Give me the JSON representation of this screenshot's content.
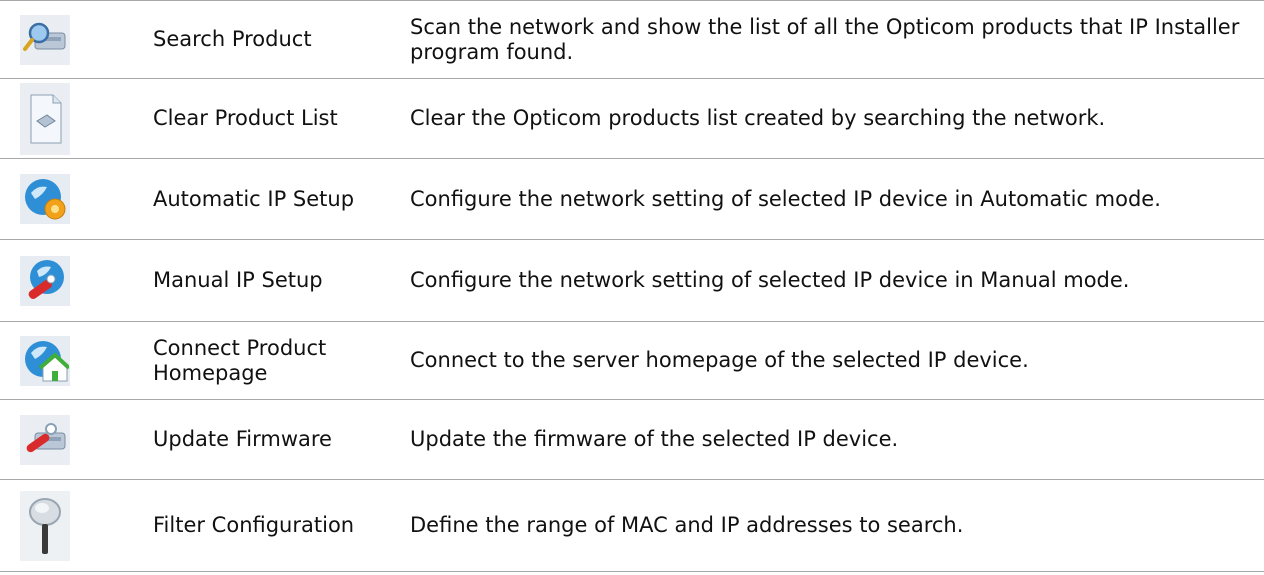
{
  "rows": [
    {
      "icon": "search-product-icon",
      "name": "Search Product",
      "desc": "Scan the network and show the list of all the Opticom products that IP Installer program found."
    },
    {
      "icon": "clear-list-icon",
      "name": "Clear Product List",
      "desc": "Clear the Opticom products list created by searching the network."
    },
    {
      "icon": "automatic-ip-setup-icon",
      "name": "Automatic IP Setup",
      "desc": "Configure the network setting of selected IP device in Automatic mode."
    },
    {
      "icon": "manual-ip-setup-icon",
      "name": "Manual IP Setup",
      "desc": "Configure the network setting of selected IP device in Manual mode."
    },
    {
      "icon": "connect-homepage-icon",
      "name": "Connect Product Homepage",
      "desc": "Connect to the server homepage of the selected IP device."
    },
    {
      "icon": "update-firmware-icon",
      "name": "Update Firmware",
      "desc": "Update the firmware of the selected IP device."
    },
    {
      "icon": "magnifier-icon",
      "name": "Filter Configuration",
      "desc": "Define the range of MAC and IP addresses to search."
    }
  ],
  "colors": {
    "border": "#a8a8a8",
    "icon_bg": "#eaeef2",
    "globe_blue": "#2e8fd6",
    "gear_orange": "#f2a21a",
    "wrench_red": "#d92b2b",
    "house_green": "#3fae3a"
  }
}
